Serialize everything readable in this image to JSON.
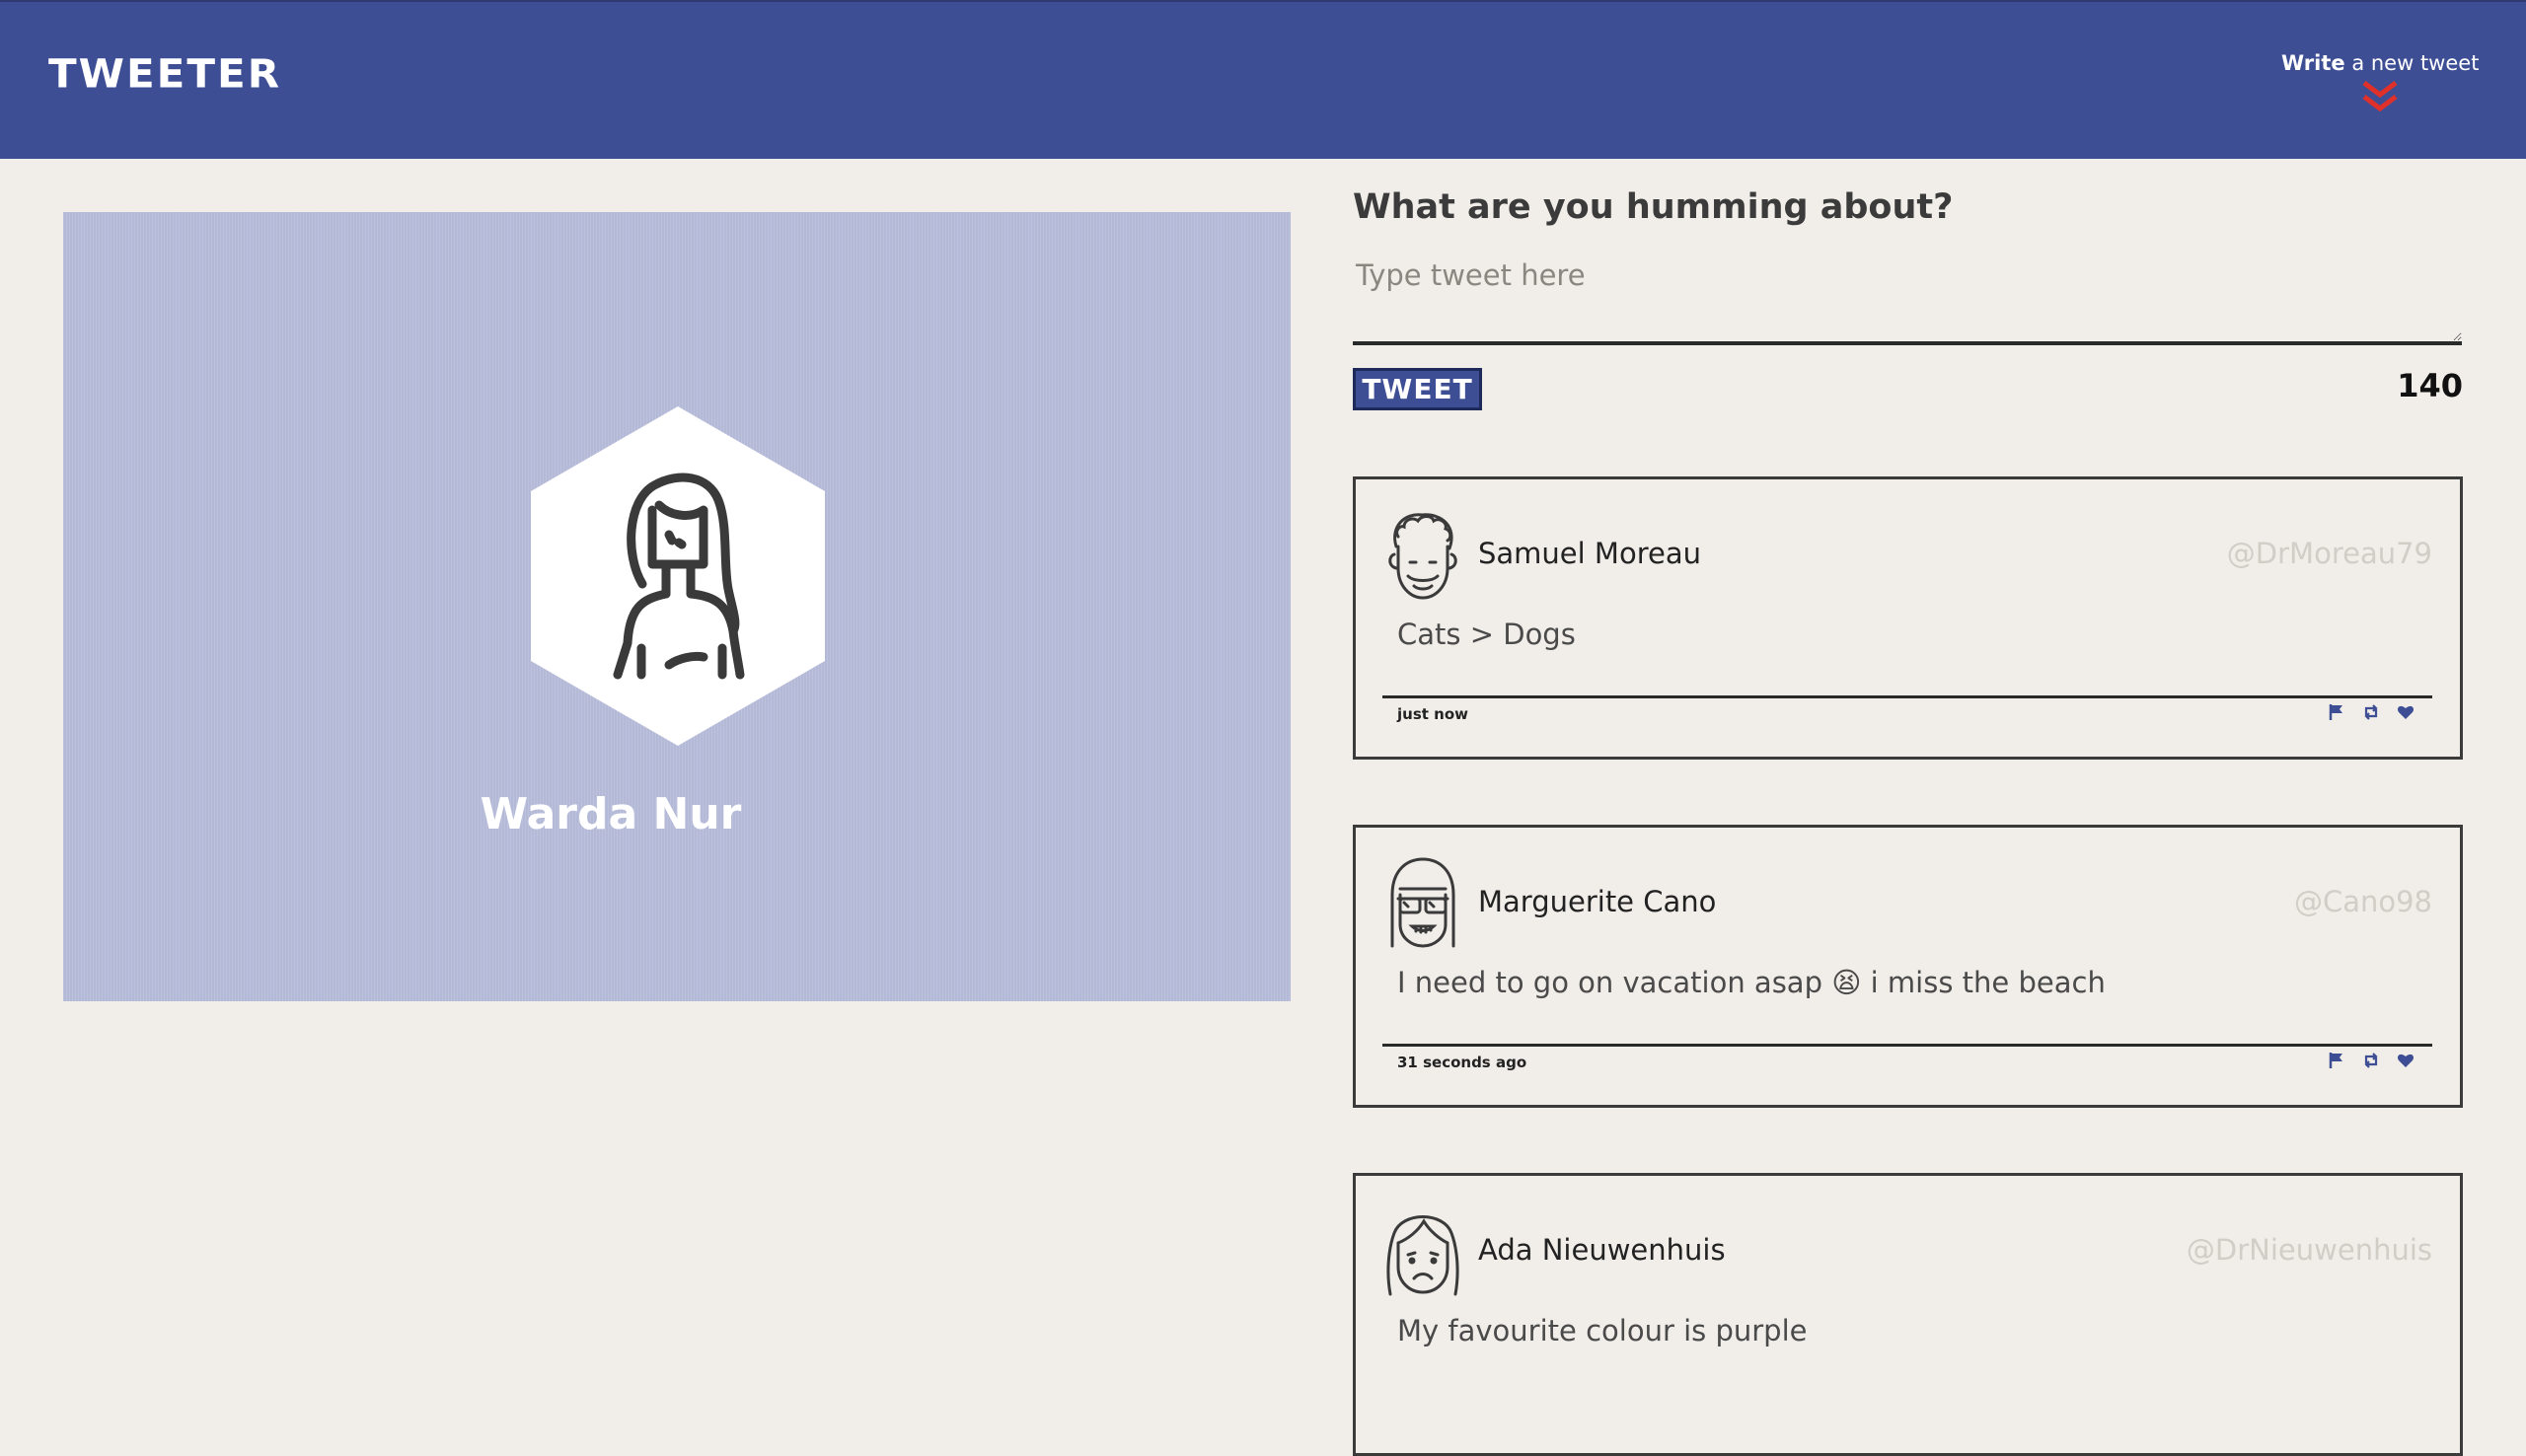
{
  "nav": {
    "brand": "TWEETER",
    "compose_bold": "Write",
    "compose_rest": " a new tweet",
    "chevron_color": "#e0302a"
  },
  "profile": {
    "name": "Warda Nur",
    "icon": "woman-avatar-icon"
  },
  "compose": {
    "heading": "What are you humming about?",
    "placeholder": "Type tweet here",
    "button_label": "TWEET",
    "counter": "140"
  },
  "tweets": [
    {
      "author": "Samuel Moreau",
      "handle": "@DrMoreau79",
      "body": "Cats > Dogs",
      "timestamp": "just now",
      "avatar": "curly-hair-man-avatar-icon"
    },
    {
      "author": "Marguerite Cano",
      "handle": "@Cano98",
      "body": "I need to go on vacation asap 😫 i miss the beach",
      "timestamp": "31 seconds ago",
      "avatar": "sunglasses-girl-avatar-icon"
    },
    {
      "author": "Ada Nieuwenhuis",
      "handle": "@DrNieuwenhuis",
      "body": "My favourite colour is purple",
      "timestamp": "",
      "avatar": "sad-woman-avatar-icon"
    }
  ],
  "colors": {
    "nav": "#3e4e94",
    "background": "#f1eee9",
    "profile_bg": "#b4b9d7",
    "icon_accent": "#3e4e94"
  }
}
